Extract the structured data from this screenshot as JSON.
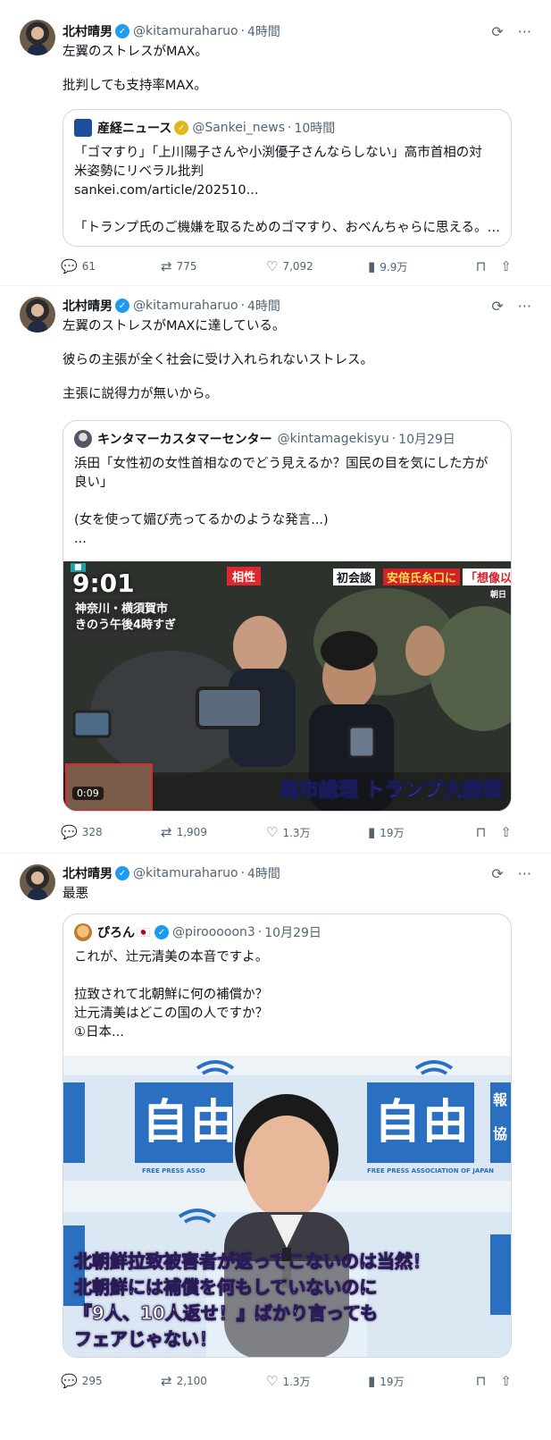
{
  "tweets": [
    {
      "name": "北村晴男",
      "handle": "@kitamuraharuo",
      "time": "4時間",
      "lines": [
        "左翼のストレスがMAX。",
        "",
        "批判しても支持率MAX。"
      ],
      "quote": {
        "name": "産経ニュース",
        "handle": "@Sankei_news",
        "time": "10時間",
        "lines": [
          "「ゴマすり」「上川陽子さんや小渕優子さんならしない」高市首相の対",
          "米姿勢にリベラル批判",
          "sankei.com/article/202510...",
          "",
          "「トランプ氏のご機嫌を取るためのゴマすり、おべんちゃらに思える。…"
        ]
      },
      "stats": {
        "replies": "61",
        "reposts": "775",
        "likes": "7,092",
        "views": "9.9万"
      }
    },
    {
      "name": "北村晴男",
      "handle": "@kitamuraharuo",
      "time": "4時間",
      "lines": [
        "左翼のストレスがMAXに達している。",
        "",
        "彼らの主張が全く社会に受け入れられないストレス。",
        "",
        "主張に説得力が無いから。"
      ],
      "quote": {
        "name": "キンタマーカスタマーセンター",
        "handle": "@kintamagekisyu",
        "time": "10月29日",
        "lines": [
          "浜田「女性初の女性首相なのでどう見えるか？国民の目を気にした方が",
          "良い」",
          "",
          "(女を使って媚び売ってるかのような発言...)",
          "..."
        ],
        "video": {
          "clock": "9:01",
          "location": "神奈川・横須賀市",
          "when": "きのう午後4時すぎ",
          "tag": "相性",
          "banner_a": "初会談",
          "banner_b": "安倍氏糸口に",
          "banner_c": "「想像以上の成果",
          "caption": "高市総理 トランプ大統領",
          "duration": "0:09",
          "corner": "朝日"
        }
      },
      "stats": {
        "replies": "328",
        "reposts": "1,909",
        "likes": "1.3万",
        "views": "19万"
      }
    },
    {
      "name": "北村晴男",
      "handle": "@kitamuraharuo",
      "time": "4時間",
      "lines": [
        "最悪"
      ],
      "quote": {
        "name": "ぴろん",
        "flag": "🇯🇵",
        "handle": "@pirooooon3",
        "time": "10月29日",
        "lines": [
          "これが、辻元清美の本音ですよ。",
          "",
          "拉致されて北朝鮮に何の補償か？",
          "辻元清美はどこの国の人ですか？",
          "①日本..."
        ],
        "image": {
          "logo": "自由",
          "org": "FREE PRESS ASSOCIATION OF JAPAN",
          "org_short": "FREE PRESS ASSO",
          "side_a": "報",
          "side_b": "協",
          "cap1": "北朝鮮拉致被害者が返ってこないのは当然！",
          "cap2": "北朝鮮には補償を何もしていないのに",
          "cap3": "『9人、10人返せ！』ばかり言っても",
          "cap4": "フェアじゃない！"
        }
      },
      "stats": {
        "replies": "295",
        "reposts": "2,100",
        "likes": "1.3万",
        "views": "19万"
      }
    }
  ],
  "icons": {
    "grok": "grok-icon",
    "more": "more-icon",
    "reply": "reply-icon",
    "repost": "repost-icon",
    "like": "like-icon",
    "views": "views-icon",
    "bookmark": "bookmark-icon",
    "share": "share-icon"
  },
  "colors": {
    "verified": "#1d9bf0",
    "gold_badge": "#e2b719",
    "muted": "#536471",
    "border": "#cfd9de"
  }
}
